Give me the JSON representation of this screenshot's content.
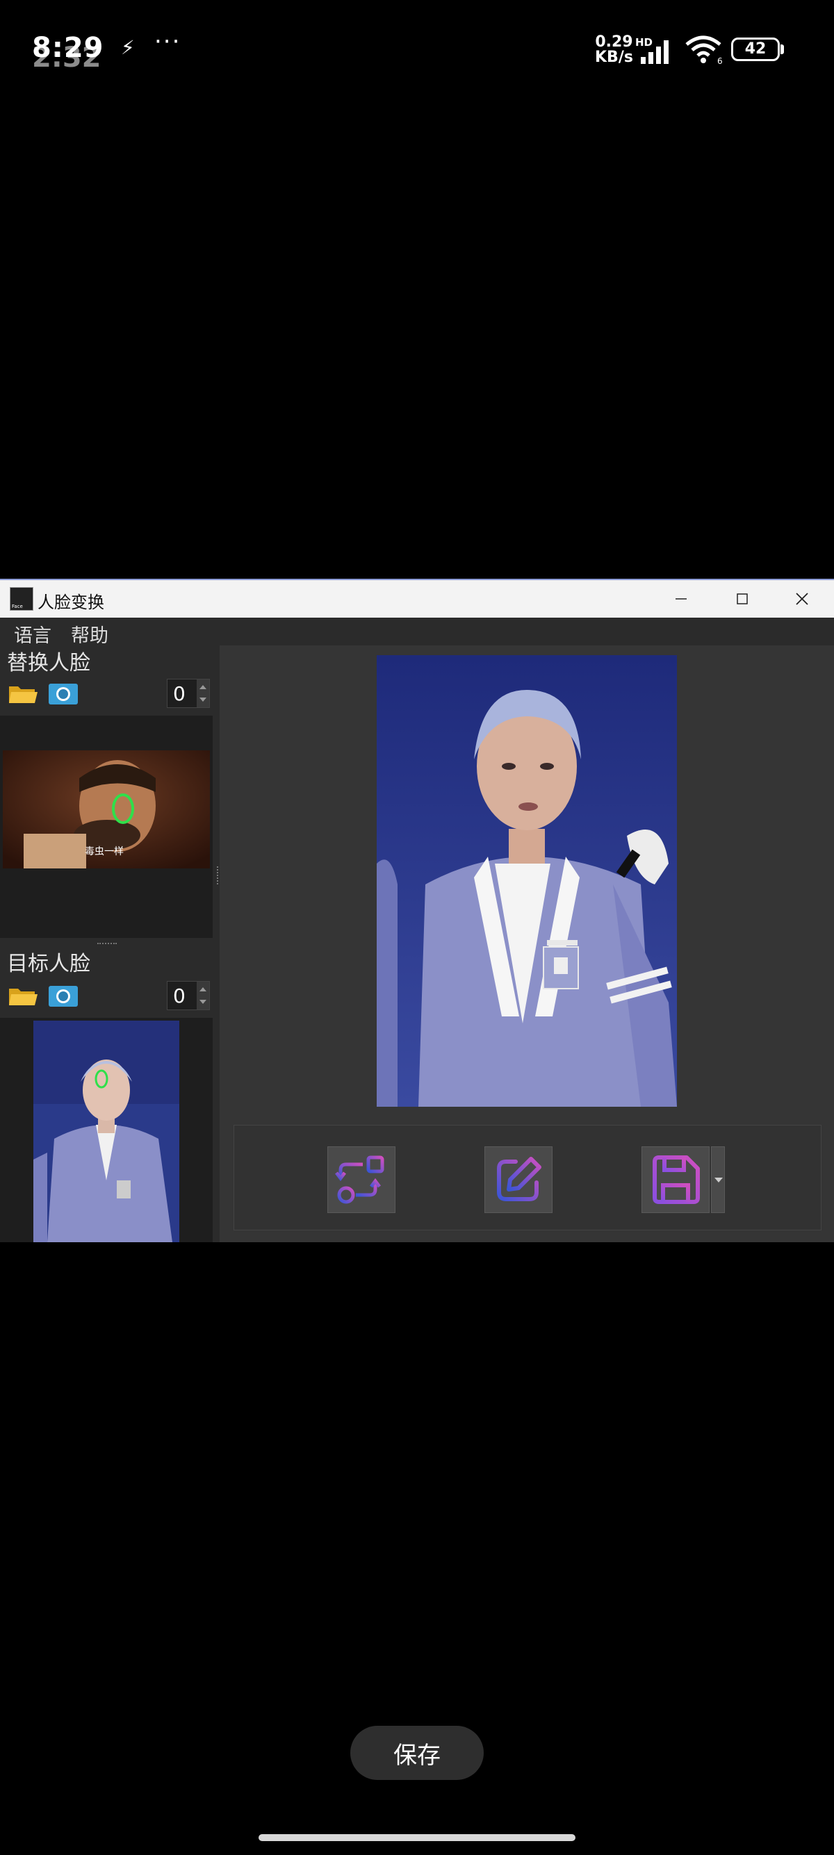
{
  "status_bar": {
    "time": "8:29",
    "time_ghost": "2:32",
    "net_speed_value": "0.29",
    "net_speed_unit": "KB/s",
    "hd": "HD",
    "battery": "42"
  },
  "window": {
    "title": "人脸变换",
    "menu": {
      "language": "语言",
      "help": "帮助"
    },
    "replace_face": {
      "label": "替换人脸",
      "count": "0",
      "thumb_caption": "毒虫一样"
    },
    "target_face": {
      "label": "目标人脸",
      "count": "0"
    }
  },
  "bottom": {
    "save_label": "保存"
  },
  "colors": {
    "window_bg": "#2b2b2b",
    "panel_bg": "#1e1e1e",
    "accent_purple": "#8a4fe0",
    "accent_pink": "#d04fc0",
    "face_marker": "#2fe04a"
  }
}
